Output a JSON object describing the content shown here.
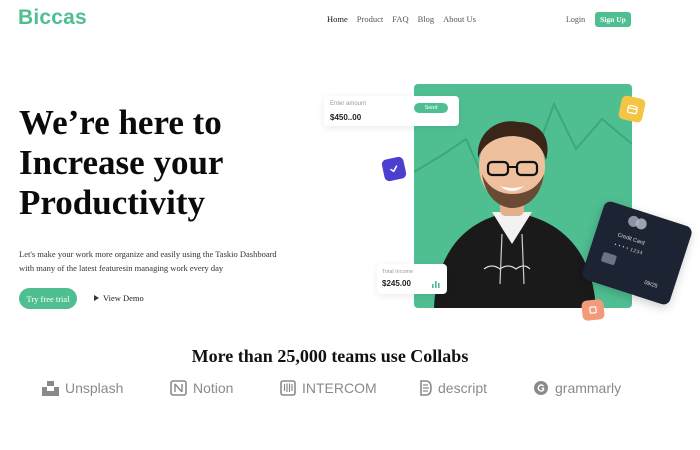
{
  "brand": {
    "logo": "Biccas"
  },
  "nav": {
    "items": [
      "Home",
      "Product",
      "FAQ",
      "Blog",
      "About Us"
    ],
    "login": "Login",
    "signup": "Sign Up"
  },
  "hero": {
    "title_lines": [
      "We’re here to",
      "Increase your",
      "Productivity"
    ],
    "subtitle_line1": "Let's make your work more organize and easily using the Taskio Dashboard",
    "subtitle_line2": "with many of the latest featuresin managing work every day",
    "cta_primary": "Try free trial",
    "cta_secondary": "View Demo"
  },
  "widgets": {
    "send": {
      "label": "Enter amount",
      "amount": "$450..00",
      "button": "Send"
    },
    "income": {
      "label": "Total Income",
      "amount": "$245.00"
    },
    "credit_card": {
      "label": "Credit Card",
      "number": "• • • •  1234",
      "expiry": "09/25"
    }
  },
  "trusted": {
    "heading": "More than 25,000 teams use Collabs",
    "logos": [
      {
        "name": "Unsplash",
        "icon": "unsplash-icon"
      },
      {
        "name": "Notion",
        "icon": "notion-icon"
      },
      {
        "name": "INTERCOM",
        "icon": "intercom-icon"
      },
      {
        "name": "descript",
        "icon": "descript-icon"
      },
      {
        "name": "grammarly",
        "icon": "grammarly-icon"
      }
    ]
  },
  "colors": {
    "accent": "#4fbf92",
    "purple": "#4b3fcf",
    "yellow": "#f4c542",
    "coral": "#f39a7a",
    "card": "#1c2333"
  }
}
